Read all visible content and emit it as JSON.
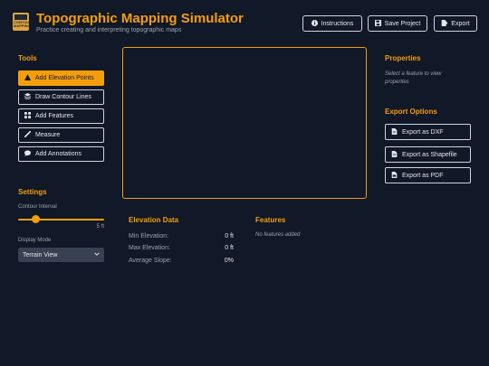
{
  "header": {
    "logo_text": "CONTOUR MAPPING",
    "title": "Topographic Mapping Simulator",
    "subtitle": "Practice creating and interpreting topographic maps",
    "buttons": {
      "instructions": "Instructions",
      "save": "Save Project",
      "export": "Export"
    }
  },
  "tools": {
    "title": "Tools",
    "items": [
      {
        "label": "Add Elevation Points",
        "icon": "warning-triangle-icon",
        "active": true
      },
      {
        "label": "Draw Contour Lines",
        "icon": "layers-icon",
        "active": false
      },
      {
        "label": "Add Features",
        "icon": "grid-icon",
        "active": false
      },
      {
        "label": "Measure",
        "icon": "ruler-icon",
        "active": false
      },
      {
        "label": "Add Annotations",
        "icon": "comment-icon",
        "active": false
      }
    ]
  },
  "settings": {
    "title": "Settings",
    "contour_interval_label": "Contour Interval",
    "contour_interval_value": "5 ft",
    "contour_interval_fraction": 0.2,
    "display_mode_label": "Display Mode",
    "display_mode_value": "Terrain View"
  },
  "elevation": {
    "title": "Elevation Data",
    "rows": [
      {
        "label": "Min Elevation:",
        "value": "0 ft"
      },
      {
        "label": "Max Elevation:",
        "value": "0 ft"
      },
      {
        "label": "Average Slope:",
        "value": "0%"
      }
    ]
  },
  "features": {
    "title": "Features",
    "empty": "No features added"
  },
  "properties": {
    "title": "Properties",
    "hint": "Select a feature to view properties"
  },
  "export_options": {
    "title": "Export Options",
    "buttons": [
      "Export as DXF",
      "Export as Shapefile",
      "Export as PDF"
    ]
  },
  "colors": {
    "accent": "#f59e0b",
    "background": "#111827"
  }
}
